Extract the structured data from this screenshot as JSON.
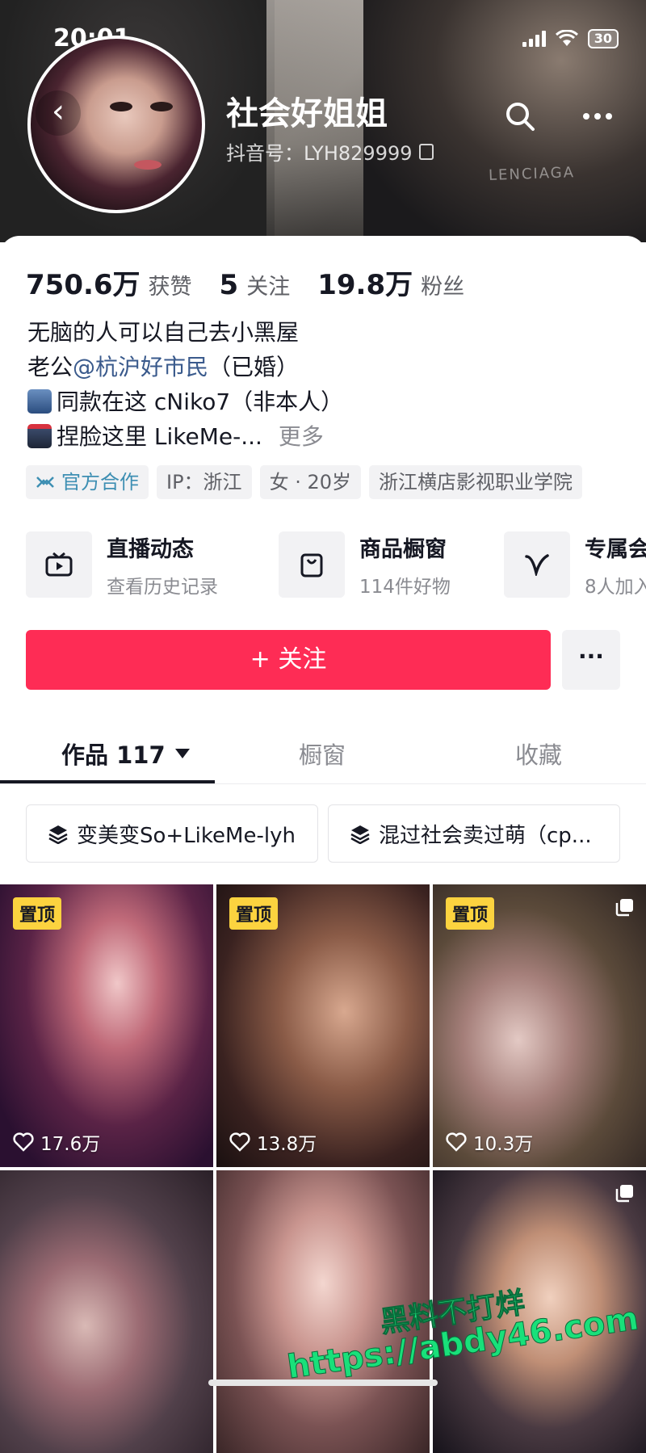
{
  "status_bar": {
    "time": "20:01",
    "battery": "30"
  },
  "header": {
    "back_icon": "‹",
    "shirt_text": "LENCIAGA",
    "name": "社会好姐姐",
    "douyin_id": "抖音号：LYH829999"
  },
  "stats": [
    {
      "value": "750.6万",
      "label": "获赞"
    },
    {
      "value": "5",
      "label": "关注"
    },
    {
      "value": "19.8万",
      "label": "粉丝"
    }
  ],
  "bio": {
    "line1": "无脑的人可以自己去小黑屋",
    "line2_prefix": "老公",
    "line2_mention": "@杭沪好市民",
    "line2_suffix": "（已婚）",
    "line3": "同款在这 cNiko7（非本人）",
    "line4": "捏脸这里 LikeMe-...",
    "more": "更多"
  },
  "tags": [
    "官方合作",
    "IP：浙江",
    "女 · 20岁",
    "浙江横店影视职业学院"
  ],
  "entries": [
    {
      "title": "直播动态",
      "sub": "查看历史记录",
      "icon": "tv-icon"
    },
    {
      "title": "商品橱窗",
      "sub": "114件好物",
      "icon": "bag-icon"
    },
    {
      "title": "专属会",
      "sub": "8人加入",
      "icon": "v-icon"
    }
  ],
  "follow_button": "+ 关注",
  "more_button": "···",
  "tabs": [
    {
      "label": "作品 117"
    },
    {
      "label": "橱窗"
    },
    {
      "label": "收藏"
    }
  ],
  "collections": [
    "变美变So+LikeMe-lyh",
    "混过社会卖过萌（cp..."
  ],
  "videos": [
    {
      "pinned": "置顶",
      "likes": "17.6万"
    },
    {
      "pinned": "置顶",
      "likes": "13.8万"
    },
    {
      "pinned": "置顶",
      "likes": "10.3万"
    },
    {},
    {},
    {}
  ],
  "watermark": {
    "line1": "黑料不打烊",
    "line2": "https://abdy46.com"
  },
  "colors": {
    "accent": "#fe2c55",
    "pin": "#fcd33f",
    "mention": "#3a5a8c",
    "official_tag": "#3e8fb3",
    "watermark": "#19e07a"
  }
}
